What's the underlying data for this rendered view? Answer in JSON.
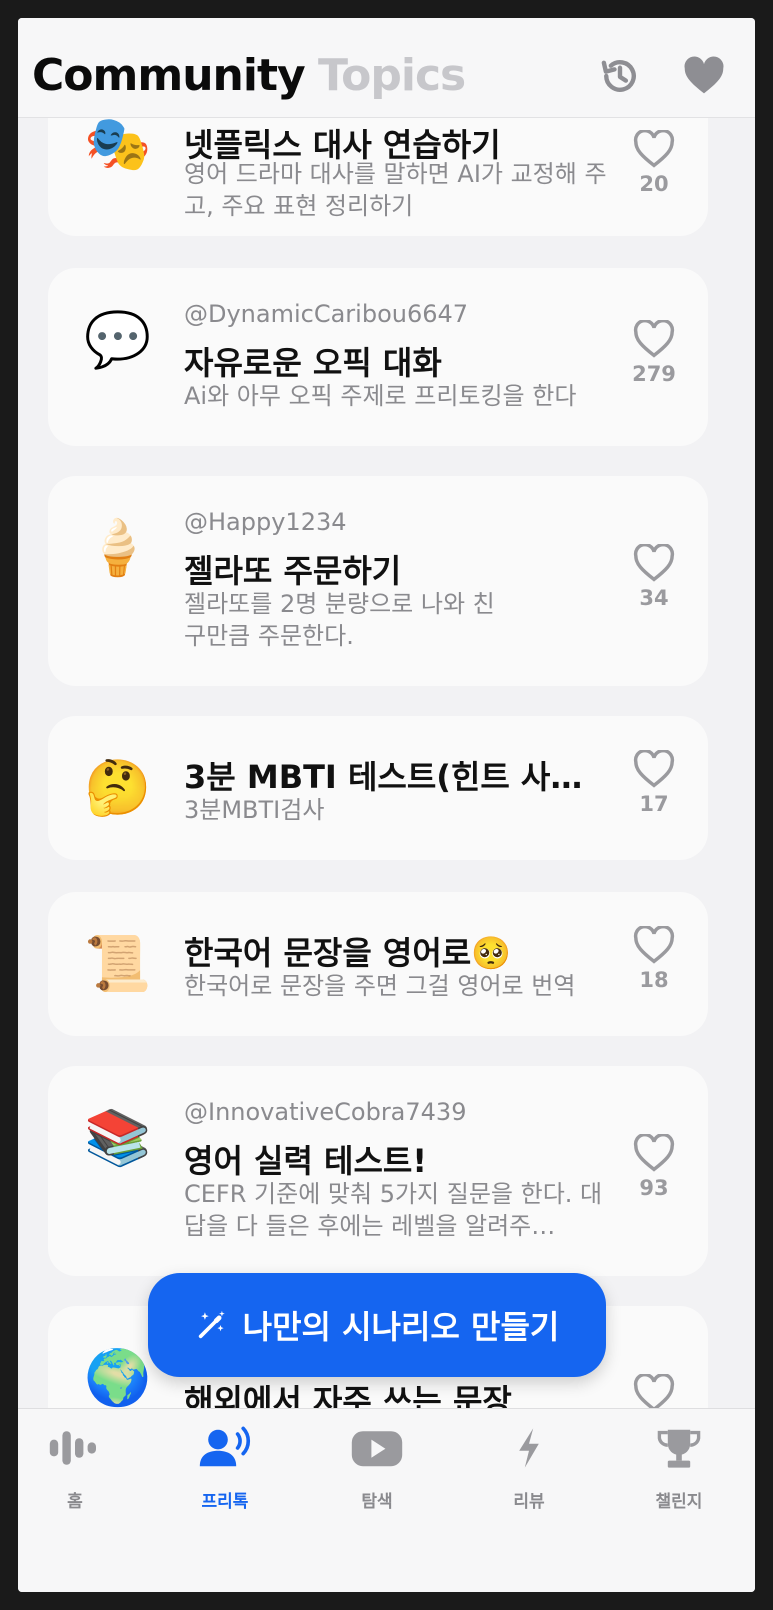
{
  "header": {
    "title": "Community",
    "secondary_title": "Topics",
    "history_icon": "history-icon",
    "favorites_icon": "heart-icon"
  },
  "cards": [
    {
      "emoji": "🎭",
      "author": "",
      "title": "넷플릭스 대사 연습하기",
      "description": "영어 드라마 대사를 말하면 AI가 교정해 주고, 주요 표현 정리하기",
      "likes": "20"
    },
    {
      "emoji": "💬",
      "author": "@DynamicCaribou6647",
      "title": "자유로운 오픽 대화",
      "description": "Ai와 아무 오픽 주제로 프리토킹을 한다",
      "likes": "279"
    },
    {
      "emoji": "🍦",
      "author": "@Happy1234",
      "title": "젤라또 주문하기",
      "description": "젤라또를 2명 분량으로 나와 친구만큼 주문한다.",
      "likes": "34"
    },
    {
      "emoji": "🤔",
      "author": "",
      "title": "3분 MBTI 테스트(힌트 사…",
      "description": "3분MBTI검사",
      "likes": "17"
    },
    {
      "emoji": "📜",
      "author": "",
      "title": "한국어 문장을 영어로🥺",
      "description": "한국어로 문장을 주면 그걸 영어로 번역",
      "likes": "18"
    },
    {
      "emoji": "📚",
      "author": "@InnovativeCobra7439",
      "title": "영어 실력 테스트!",
      "description": "CEFR 기준에 맞춰 5가지 질문을 한다. 대답을 다 들은 후에는 레벨을 알려주…",
      "likes": "93"
    },
    {
      "emoji": "🌍",
      "author": "",
      "title": "해외에서 자주 쓰는 문장",
      "description": "",
      "likes": ""
    }
  ],
  "fab": {
    "label": "나만의 시나리오 만들기",
    "icon": "magic-wand-icon"
  },
  "tabs": [
    {
      "label": "홈",
      "icon": "waveform-icon",
      "active": false
    },
    {
      "label": "프리톡",
      "icon": "person-voice-icon",
      "active": true
    },
    {
      "label": "탐색",
      "icon": "play-icon",
      "active": false
    },
    {
      "label": "리뷰",
      "icon": "bolt-icon",
      "active": false
    },
    {
      "label": "챌린지",
      "icon": "trophy-icon",
      "active": false
    }
  ],
  "colors": {
    "accent": "#1565f0",
    "muted": "#8a8a8e",
    "topics_inactive": "#c7c7cb"
  }
}
